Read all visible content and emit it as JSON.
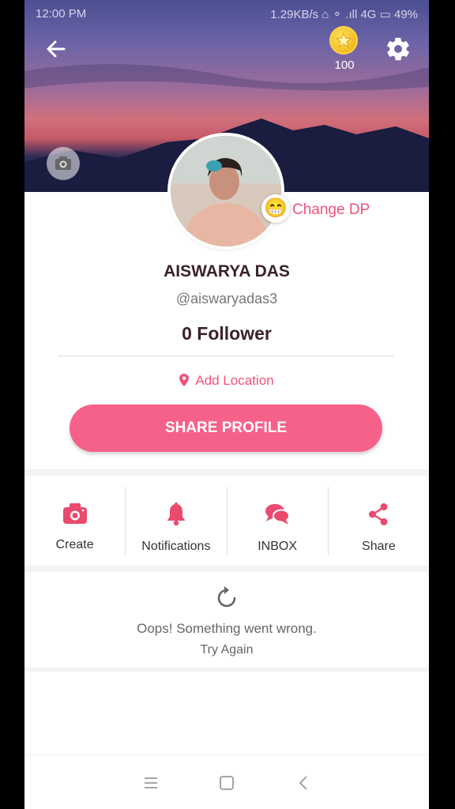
{
  "status_bar": {
    "time": "12:00 PM",
    "right": "1.29KB/s  ⌂  ⚬  .ıll  4G  ▭ 49%"
  },
  "header": {
    "coins": "100",
    "change_dp": "Change DP",
    "emoji": "😁"
  },
  "profile": {
    "name": "AISWARYA DAS",
    "handle": "@aiswaryadas3",
    "followers": "0 Follower",
    "location": "Add Location",
    "share_button": "SHARE PROFILE"
  },
  "actions": [
    {
      "label": "Create",
      "icon": "camera-icon"
    },
    {
      "label": "Notifications",
      "icon": "bell-icon"
    },
    {
      "label": "INBOX",
      "icon": "chat-icon"
    },
    {
      "label": "Share",
      "icon": "share-icon"
    }
  ],
  "error": {
    "message": "Oops! Something went wrong.",
    "retry": "Try Again"
  },
  "colors": {
    "accent": "#f6618a",
    "accent_text": "#f0527d",
    "dark_text": "#3b2226"
  }
}
